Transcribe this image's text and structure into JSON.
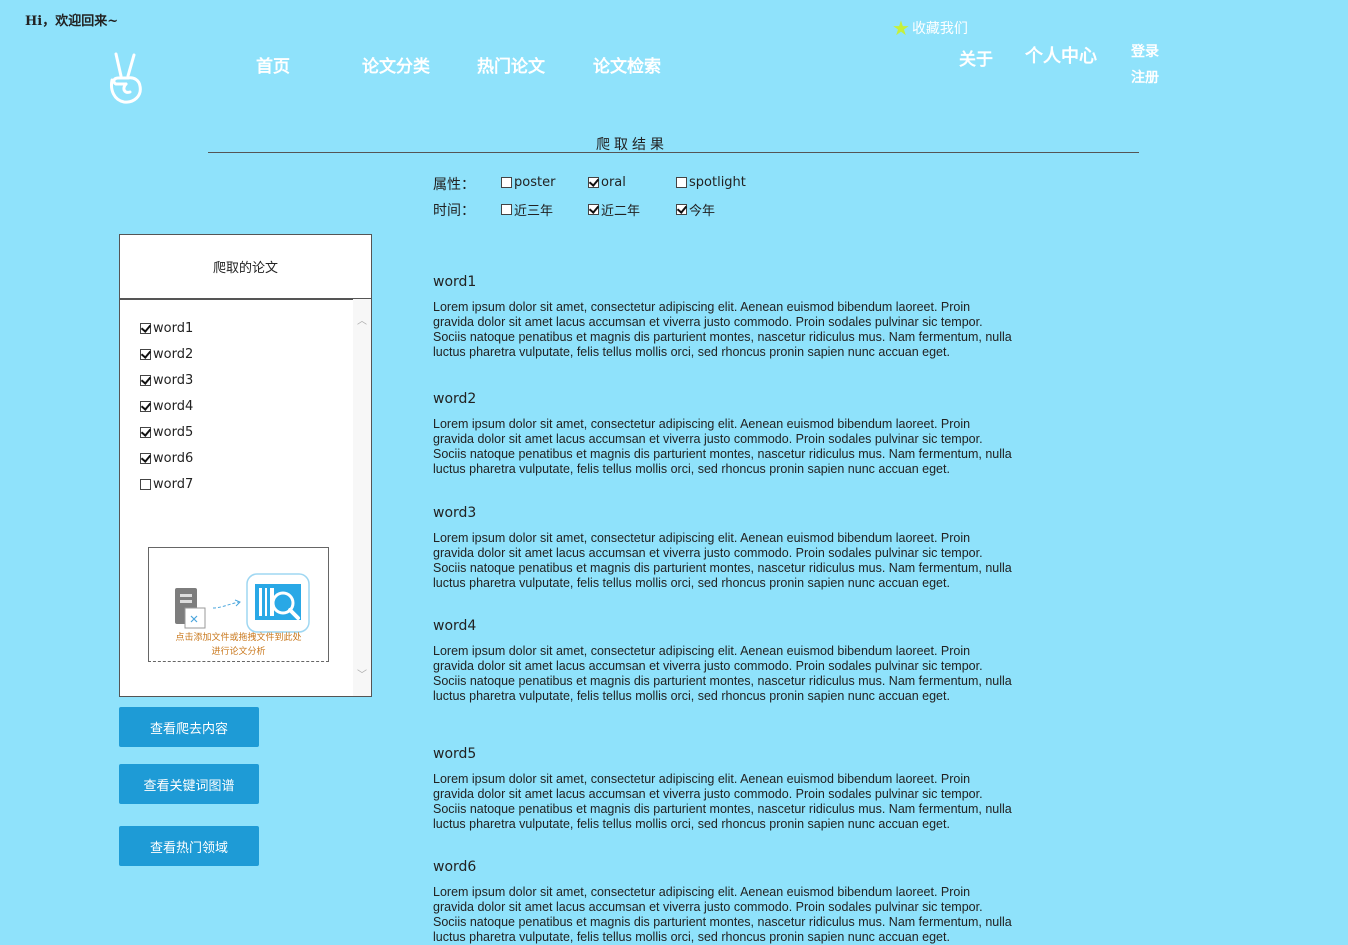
{
  "greeting": "Hi，欢迎回来~",
  "nav": {
    "items": [
      "首页",
      "论文分类",
      "热门论文",
      "论文检索"
    ],
    "favorite": "收藏我们",
    "about": "关于",
    "personal_center": "个人中心",
    "login": "登录",
    "register": "注册"
  },
  "section_title": "爬取结果",
  "filters": {
    "attr_label": "属性：",
    "time_label": "时间：",
    "attributes": [
      {
        "label": "poster",
        "checked": false
      },
      {
        "label": "oral",
        "checked": true
      },
      {
        "label": "spotlight",
        "checked": false
      }
    ],
    "times": [
      {
        "label": "近三年",
        "checked": false
      },
      {
        "label": "近二年",
        "checked": true
      },
      {
        "label": "今年",
        "checked": true
      }
    ]
  },
  "panel": {
    "title": "爬取的论文",
    "items": [
      {
        "label": "word1",
        "checked": true
      },
      {
        "label": "word2",
        "checked": true
      },
      {
        "label": "word3",
        "checked": true
      },
      {
        "label": "word4",
        "checked": true
      },
      {
        "label": "word5",
        "checked": true
      },
      {
        "label": "word6",
        "checked": true
      },
      {
        "label": "word7",
        "checked": false
      }
    ],
    "upload_text_line1": "点击添加文件或拖拽文件到此处",
    "upload_text_line2": "进行论文分析"
  },
  "buttons": {
    "view_crawled": "查看爬去内容",
    "view_keyword_graph": "查看关键词图谱",
    "view_hot_fields": "查看热门领域"
  },
  "entries": [
    {
      "title": "word1",
      "body": "Lorem ipsum dolor sit amet, consectetur adipiscing elit. Aenean euismod bibendum laoreet. Proin gravida dolor sit amet lacus accumsan et viverra justo commodo. Proin sodales pulvinar sic tempor. Sociis natoque penatibus et magnis dis parturient montes, nascetur ridiculus mus. Nam fermentum, nulla luctus pharetra vulputate, felis tellus mollis orci, sed rhoncus pronin sapien nunc accuan eget."
    },
    {
      "title": "word2",
      "body": "Lorem ipsum dolor sit amet, consectetur adipiscing elit. Aenean euismod bibendum laoreet. Proin gravida dolor sit amet lacus accumsan et viverra justo commodo. Proin sodales pulvinar sic tempor. Sociis natoque penatibus et magnis dis parturient montes, nascetur ridiculus mus. Nam fermentum, nulla luctus pharetra vulputate, felis tellus mollis orci, sed rhoncus pronin sapien nunc accuan eget."
    },
    {
      "title": "word3",
      "body": "Lorem ipsum dolor sit amet, consectetur adipiscing elit. Aenean euismod bibendum laoreet. Proin gravida dolor sit amet lacus accumsan et viverra justo commodo. Proin sodales pulvinar sic tempor. Sociis natoque penatibus et magnis dis parturient montes, nascetur ridiculus mus. Nam fermentum, nulla luctus pharetra vulputate, felis tellus mollis orci, sed rhoncus pronin sapien nunc accuan eget."
    },
    {
      "title": "word4",
      "body": "Lorem ipsum dolor sit amet, consectetur adipiscing elit. Aenean euismod bibendum laoreet. Proin gravida dolor sit amet lacus accumsan et viverra justo commodo. Proin sodales pulvinar sic tempor. Sociis natoque penatibus et magnis dis parturient montes, nascetur ridiculus mus. Nam fermentum, nulla luctus pharetra vulputate, felis tellus mollis orci, sed rhoncus pronin sapien nunc accuan eget."
    },
    {
      "title": "word5",
      "body": "Lorem ipsum dolor sit amet, consectetur adipiscing elit. Aenean euismod bibendum laoreet. Proin gravida dolor sit amet lacus accumsan et viverra justo commodo. Proin sodales pulvinar sic tempor. Sociis natoque penatibus et magnis dis parturient montes, nascetur ridiculus mus. Nam fermentum, nulla luctus pharetra vulputate, felis tellus mollis orci, sed rhoncus pronin sapien nunc accuan eget."
    },
    {
      "title": "word6",
      "body": "Lorem ipsum dolor sit amet, consectetur adipiscing elit. Aenean euismod bibendum laoreet. Proin gravida dolor sit amet lacus accumsan et viverra justo commodo. Proin sodales pulvinar sic tempor. Sociis natoque penatibus et magnis dis parturient montes, nascetur ridiculus mus. Nam fermentum, nulla luctus pharetra vulputate, felis tellus mollis orci, sed rhoncus pronin sapien nunc accuan eget."
    }
  ]
}
